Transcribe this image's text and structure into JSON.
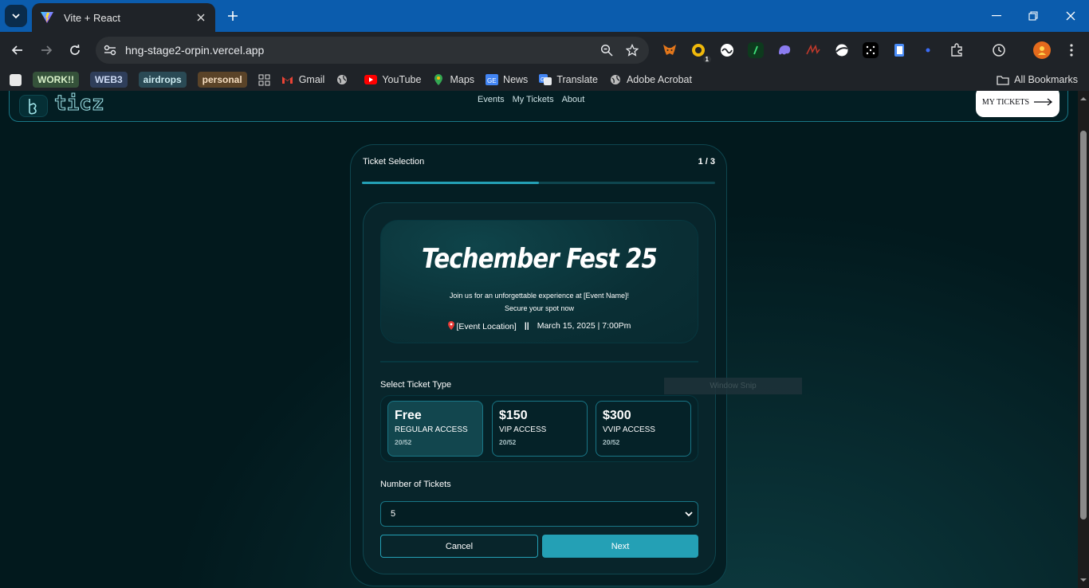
{
  "browser": {
    "tab_title": "Vite + React",
    "url": "hng-stage2-orpin.vercel.app",
    "extensions": [
      {
        "icon": "metamask-fox-icon",
        "color": "#e2761b"
      },
      {
        "icon": "coin-badge-icon",
        "color": "#f0b90b",
        "badge": "1"
      },
      {
        "icon": "wave-icon",
        "color": "#ffffff"
      },
      {
        "icon": "terminal-icon",
        "color": "#1a8f3c"
      },
      {
        "icon": "ghost-icon",
        "color": "#8b7cf0"
      },
      {
        "icon": "signature-icon",
        "color": "#c0392b"
      },
      {
        "icon": "planet-icon",
        "color": "#ffffff"
      },
      {
        "icon": "dots-grid-icon",
        "color": "#ffffff"
      },
      {
        "icon": "document-icon",
        "color": "#4a8cf7"
      },
      {
        "icon": "dot-icon",
        "color": "#3b6cf6"
      },
      {
        "icon": "puzzle-icon",
        "color": "#e0e0e0"
      }
    ]
  },
  "bookmarks": {
    "items": [
      {
        "label": "WORK!!",
        "type": "chip",
        "bg": "#35523a"
      },
      {
        "label": "WEB3",
        "type": "chip",
        "bg": "#2f3e5a"
      },
      {
        "label": "airdrops",
        "type": "chip",
        "bg": "#2a4a55"
      },
      {
        "label": "personal",
        "type": "chip",
        "bg": "#5a4328"
      },
      {
        "label": "Gmail",
        "type": "link",
        "icon": "gmail-icon"
      },
      {
        "label": "YouTube",
        "type": "link",
        "icon": "youtube-icon"
      },
      {
        "label": "Maps",
        "type": "link",
        "icon": "maps-icon"
      },
      {
        "label": "News",
        "type": "link",
        "icon": "news-icon"
      },
      {
        "label": "Translate",
        "type": "link",
        "icon": "translate-icon"
      },
      {
        "label": "Adobe Acrobat",
        "type": "link",
        "icon": "globe-icon"
      }
    ],
    "all_bookmarks": "All Bookmarks"
  },
  "header": {
    "logo": "ticz",
    "nav": [
      "Events",
      "My Tickets",
      "About"
    ],
    "my_tickets_button": "MY TICKETS"
  },
  "ticket_card": {
    "title": "Ticket Selection",
    "step": "1 / 3",
    "progress": 0.5,
    "event": {
      "title": "Techember Fest 25",
      "description_line1": "Join us for an unforgettable experience at [Event Name]!",
      "description_line2": "Secure your spot now",
      "location": "[Event Location]",
      "separator": "||",
      "datetime": "March 15, 2025 | 7:00Pm"
    },
    "select_ticket_label": "Select Ticket Type",
    "ticket_types": [
      {
        "price": "Free",
        "access": "REGULAR ACCESS",
        "availability": "20/52",
        "selected": true
      },
      {
        "price": "$150",
        "access": "VIP ACCESS",
        "availability": "20/52",
        "selected": false
      },
      {
        "price": "$300",
        "access": "VVIP ACCESS",
        "availability": "20/52",
        "selected": false
      }
    ],
    "number_label": "Number of Tickets",
    "number_value": "5",
    "cancel": "Cancel",
    "next": "Next"
  },
  "overlay": {
    "snip_text": "Window Snip"
  },
  "colors": {
    "accent": "#24a0b5",
    "border": "#197686",
    "page_bg": "#02191d"
  }
}
